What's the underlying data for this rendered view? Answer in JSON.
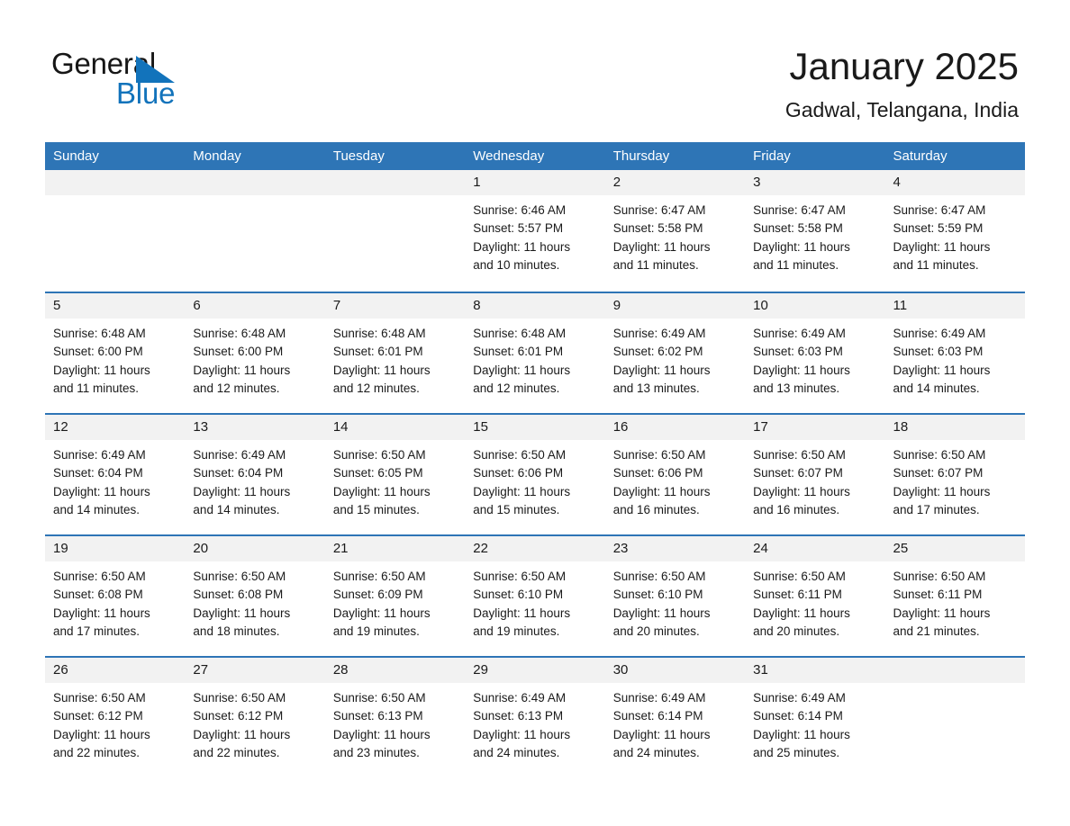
{
  "brand": {
    "name_part1": "General",
    "name_part2": "Blue",
    "logo_color": "#1273bb"
  },
  "header": {
    "month_title": "January 2025",
    "location": "Gadwal, Telangana, India"
  },
  "theme": {
    "header_blue": "#2e75b6",
    "daynum_band": "#f2f2f2",
    "text": "#1a1a1a"
  },
  "day_headers": [
    "Sunday",
    "Monday",
    "Tuesday",
    "Wednesday",
    "Thursday",
    "Friday",
    "Saturday"
  ],
  "weeks": [
    [
      {
        "day": "",
        "lines": []
      },
      {
        "day": "",
        "lines": []
      },
      {
        "day": "",
        "lines": []
      },
      {
        "day": "1",
        "lines": [
          "Sunrise: 6:46 AM",
          "Sunset: 5:57 PM",
          "Daylight: 11 hours",
          "and 10 minutes."
        ]
      },
      {
        "day": "2",
        "lines": [
          "Sunrise: 6:47 AM",
          "Sunset: 5:58 PM",
          "Daylight: 11 hours",
          "and 11 minutes."
        ]
      },
      {
        "day": "3",
        "lines": [
          "Sunrise: 6:47 AM",
          "Sunset: 5:58 PM",
          "Daylight: 11 hours",
          "and 11 minutes."
        ]
      },
      {
        "day": "4",
        "lines": [
          "Sunrise: 6:47 AM",
          "Sunset: 5:59 PM",
          "Daylight: 11 hours",
          "and 11 minutes."
        ]
      }
    ],
    [
      {
        "day": "5",
        "lines": [
          "Sunrise: 6:48 AM",
          "Sunset: 6:00 PM",
          "Daylight: 11 hours",
          "and 11 minutes."
        ]
      },
      {
        "day": "6",
        "lines": [
          "Sunrise: 6:48 AM",
          "Sunset: 6:00 PM",
          "Daylight: 11 hours",
          "and 12 minutes."
        ]
      },
      {
        "day": "7",
        "lines": [
          "Sunrise: 6:48 AM",
          "Sunset: 6:01 PM",
          "Daylight: 11 hours",
          "and 12 minutes."
        ]
      },
      {
        "day": "8",
        "lines": [
          "Sunrise: 6:48 AM",
          "Sunset: 6:01 PM",
          "Daylight: 11 hours",
          "and 12 minutes."
        ]
      },
      {
        "day": "9",
        "lines": [
          "Sunrise: 6:49 AM",
          "Sunset: 6:02 PM",
          "Daylight: 11 hours",
          "and 13 minutes."
        ]
      },
      {
        "day": "10",
        "lines": [
          "Sunrise: 6:49 AM",
          "Sunset: 6:03 PM",
          "Daylight: 11 hours",
          "and 13 minutes."
        ]
      },
      {
        "day": "11",
        "lines": [
          "Sunrise: 6:49 AM",
          "Sunset: 6:03 PM",
          "Daylight: 11 hours",
          "and 14 minutes."
        ]
      }
    ],
    [
      {
        "day": "12",
        "lines": [
          "Sunrise: 6:49 AM",
          "Sunset: 6:04 PM",
          "Daylight: 11 hours",
          "and 14 minutes."
        ]
      },
      {
        "day": "13",
        "lines": [
          "Sunrise: 6:49 AM",
          "Sunset: 6:04 PM",
          "Daylight: 11 hours",
          "and 14 minutes."
        ]
      },
      {
        "day": "14",
        "lines": [
          "Sunrise: 6:50 AM",
          "Sunset: 6:05 PM",
          "Daylight: 11 hours",
          "and 15 minutes."
        ]
      },
      {
        "day": "15",
        "lines": [
          "Sunrise: 6:50 AM",
          "Sunset: 6:06 PM",
          "Daylight: 11 hours",
          "and 15 minutes."
        ]
      },
      {
        "day": "16",
        "lines": [
          "Sunrise: 6:50 AM",
          "Sunset: 6:06 PM",
          "Daylight: 11 hours",
          "and 16 minutes."
        ]
      },
      {
        "day": "17",
        "lines": [
          "Sunrise: 6:50 AM",
          "Sunset: 6:07 PM",
          "Daylight: 11 hours",
          "and 16 minutes."
        ]
      },
      {
        "day": "18",
        "lines": [
          "Sunrise: 6:50 AM",
          "Sunset: 6:07 PM",
          "Daylight: 11 hours",
          "and 17 minutes."
        ]
      }
    ],
    [
      {
        "day": "19",
        "lines": [
          "Sunrise: 6:50 AM",
          "Sunset: 6:08 PM",
          "Daylight: 11 hours",
          "and 17 minutes."
        ]
      },
      {
        "day": "20",
        "lines": [
          "Sunrise: 6:50 AM",
          "Sunset: 6:08 PM",
          "Daylight: 11 hours",
          "and 18 minutes."
        ]
      },
      {
        "day": "21",
        "lines": [
          "Sunrise: 6:50 AM",
          "Sunset: 6:09 PM",
          "Daylight: 11 hours",
          "and 19 minutes."
        ]
      },
      {
        "day": "22",
        "lines": [
          "Sunrise: 6:50 AM",
          "Sunset: 6:10 PM",
          "Daylight: 11 hours",
          "and 19 minutes."
        ]
      },
      {
        "day": "23",
        "lines": [
          "Sunrise: 6:50 AM",
          "Sunset: 6:10 PM",
          "Daylight: 11 hours",
          "and 20 minutes."
        ]
      },
      {
        "day": "24",
        "lines": [
          "Sunrise: 6:50 AM",
          "Sunset: 6:11 PM",
          "Daylight: 11 hours",
          "and 20 minutes."
        ]
      },
      {
        "day": "25",
        "lines": [
          "Sunrise: 6:50 AM",
          "Sunset: 6:11 PM",
          "Daylight: 11 hours",
          "and 21 minutes."
        ]
      }
    ],
    [
      {
        "day": "26",
        "lines": [
          "Sunrise: 6:50 AM",
          "Sunset: 6:12 PM",
          "Daylight: 11 hours",
          "and 22 minutes."
        ]
      },
      {
        "day": "27",
        "lines": [
          "Sunrise: 6:50 AM",
          "Sunset: 6:12 PM",
          "Daylight: 11 hours",
          "and 22 minutes."
        ]
      },
      {
        "day": "28",
        "lines": [
          "Sunrise: 6:50 AM",
          "Sunset: 6:13 PM",
          "Daylight: 11 hours",
          "and 23 minutes."
        ]
      },
      {
        "day": "29",
        "lines": [
          "Sunrise: 6:49 AM",
          "Sunset: 6:13 PM",
          "Daylight: 11 hours",
          "and 24 minutes."
        ]
      },
      {
        "day": "30",
        "lines": [
          "Sunrise: 6:49 AM",
          "Sunset: 6:14 PM",
          "Daylight: 11 hours",
          "and 24 minutes."
        ]
      },
      {
        "day": "31",
        "lines": [
          "Sunrise: 6:49 AM",
          "Sunset: 6:14 PM",
          "Daylight: 11 hours",
          "and 25 minutes."
        ]
      },
      {
        "day": "",
        "lines": []
      }
    ]
  ]
}
